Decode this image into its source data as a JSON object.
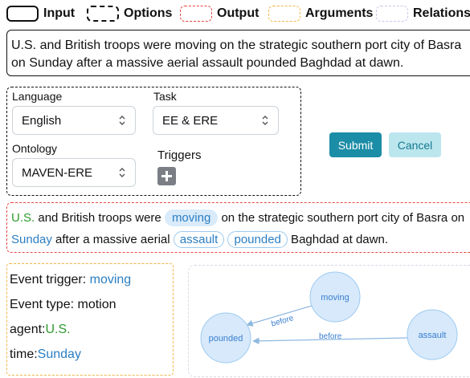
{
  "legend": {
    "input": "Input",
    "options": "Options",
    "output": "Output",
    "arguments": "Arguments",
    "relations": "Relations"
  },
  "input_text": "U.S. and British troops were moving on the strategic southern port city of Basra on Sunday after a massive aerial assault pounded Baghdad at dawn.",
  "options": {
    "language_label": "Language",
    "language_value": "English",
    "task_label": "Task",
    "task_value": "EE & ERE",
    "ontology_label": "Ontology",
    "ontology_value": "MAVEN-ERE",
    "triggers_label": "Triggers"
  },
  "buttons": {
    "submit": "Submit",
    "cancel": "Cancel"
  },
  "output": {
    "seg1": "U.S.",
    "seg2": " and British troops were ",
    "trig1": "moving",
    "seg3": " on the strategic southern port city of Basra on",
    "seg4": "Sunday",
    "seg5": " after a massive aerial ",
    "trig2": "assault",
    "trig3": "pounded",
    "seg6": " Baghdad at dawn."
  },
  "arguments": {
    "trigger_label": "Event trigger: ",
    "trigger_value": "moving",
    "type_label": "Event type: ",
    "type_value": "motion",
    "agent_label": "agent:",
    "agent_value": "U.S.",
    "time_label": "time:",
    "time_value": "Sunday"
  },
  "relations": {
    "nodes": {
      "moving": "moving",
      "pounded": "pounded",
      "assault": "assault"
    },
    "edges": {
      "moving_pounded": "before",
      "assault_pounded": "before"
    }
  },
  "colors": {
    "submit_bg": "#1c8da6",
    "cancel_bg": "#bce6ee",
    "entity_green": "#2e9a2e",
    "entity_blue": "#2b7ec2",
    "output_border": "#e8443f",
    "arguments_border": "#f2b54a"
  }
}
